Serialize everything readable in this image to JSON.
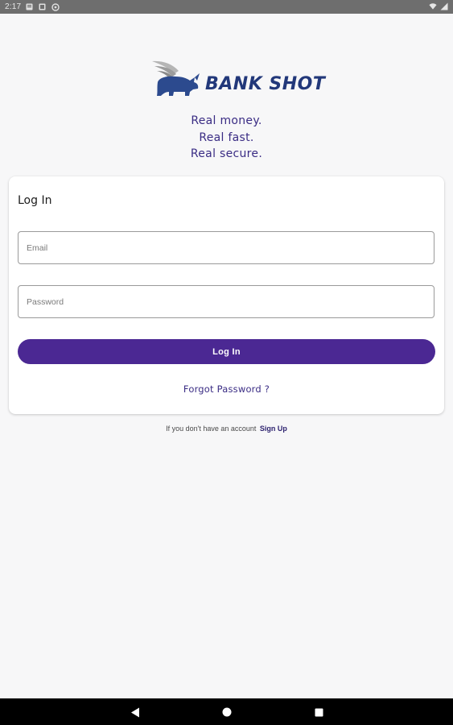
{
  "status_bar": {
    "time": "2:17",
    "icons": [
      "notification-icon",
      "notification-icon",
      "sync-icon",
      "wifi-icon",
      "signal-icon"
    ]
  },
  "brand": {
    "name": "BANK SHOT",
    "logo": "winged-rhino-logo",
    "colors": {
      "primary": "#22387a",
      "wing": "#a9a9a9"
    }
  },
  "tagline": {
    "line1": "Real money.",
    "line2": "Real fast.",
    "line3": "Real secure."
  },
  "login_card": {
    "title": "Log In",
    "email_placeholder": "Email",
    "email_value": "",
    "password_placeholder": "Password",
    "password_value": "",
    "login_button": "Log In",
    "forgot_link": "Forgot Password ?"
  },
  "signup": {
    "prompt": "If you don't have an account",
    "link": "Sign Up"
  },
  "nav_bar": {
    "back": "back-icon",
    "home": "home-icon",
    "recents": "recents-icon"
  },
  "colors": {
    "accent": "#4b2893",
    "text_accent": "#3a2c84",
    "background": "#f7f7f8"
  }
}
